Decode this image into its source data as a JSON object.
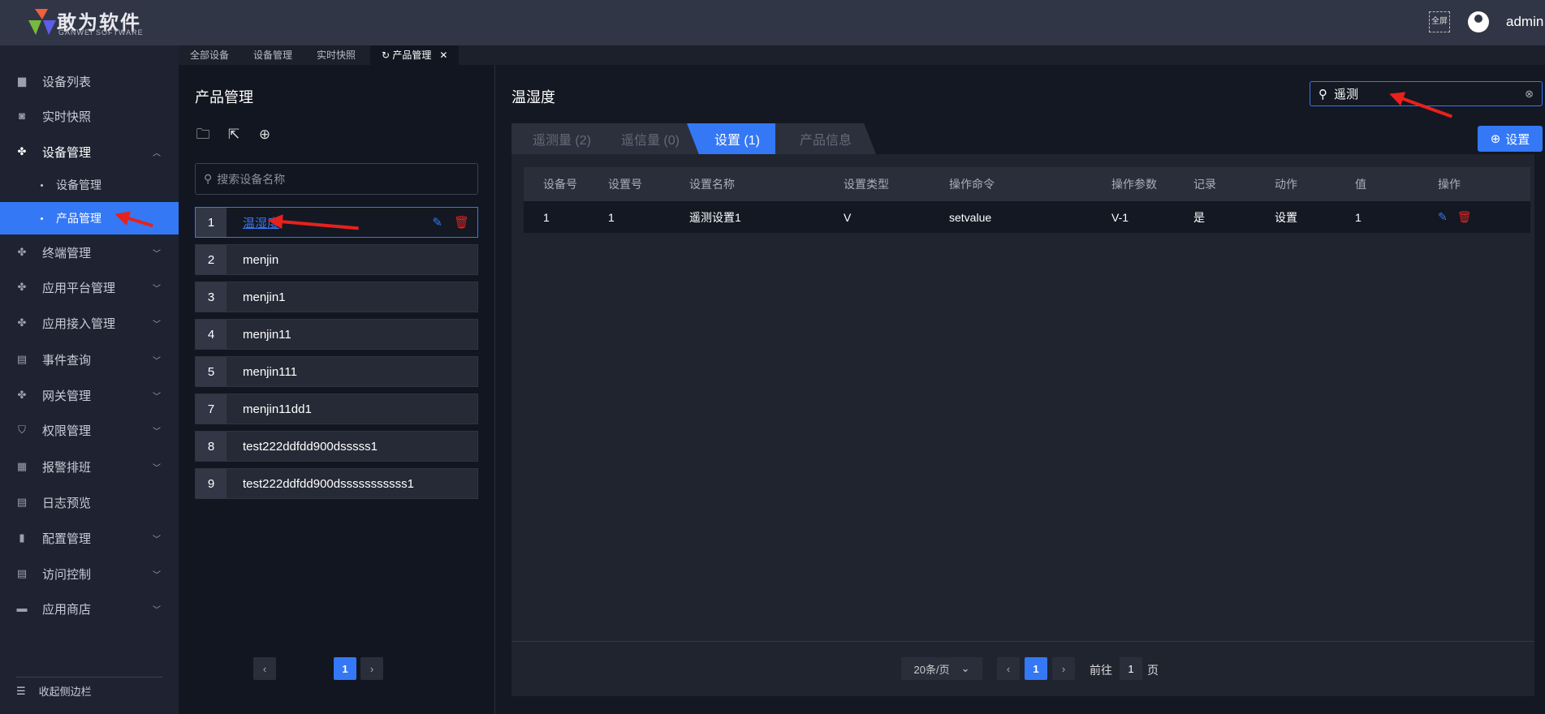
{
  "header": {
    "brand": "敢为软件",
    "brand_sub": "GANWEI SOFTWARE",
    "fullscreen": "全屏",
    "username": "admin"
  },
  "sidebar": {
    "items": [
      {
        "label": "设备列表",
        "icon": "monitor-icon"
      },
      {
        "label": "实时快照",
        "icon": "camera-icon"
      },
      {
        "label": "设备管理",
        "icon": "grid-icon",
        "open": true,
        "children": [
          {
            "label": "设备管理"
          },
          {
            "label": "产品管理",
            "active": true
          }
        ]
      },
      {
        "label": "终端管理",
        "icon": "grid-icon"
      },
      {
        "label": "应用平台管理",
        "icon": "grid-icon"
      },
      {
        "label": "应用接入管理",
        "icon": "grid-icon"
      },
      {
        "label": "事件查询",
        "icon": "document-icon"
      },
      {
        "label": "网关管理",
        "icon": "grid-icon"
      },
      {
        "label": "权限管理",
        "icon": "shield-icon"
      },
      {
        "label": "报警排班",
        "icon": "calendar-icon"
      },
      {
        "label": "日志预览",
        "icon": "log-icon"
      },
      {
        "label": "配置管理",
        "icon": "bookmark-icon"
      },
      {
        "label": "访问控制",
        "icon": "document-icon"
      },
      {
        "label": "应用商店",
        "icon": "store-icon"
      }
    ],
    "collapse_label": "收起侧边栏"
  },
  "page_tabs": [
    {
      "label": "全部设备"
    },
    {
      "label": "设备管理"
    },
    {
      "label": "实时快照"
    },
    {
      "label": "产品管理",
      "active": true
    }
  ],
  "left": {
    "title": "产品管理",
    "search_placeholder": "搜索设备名称",
    "products": [
      {
        "num": "1",
        "name": "温湿度"
      },
      {
        "num": "2",
        "name": "menjin"
      },
      {
        "num": "3",
        "name": "menjin1"
      },
      {
        "num": "4",
        "name": "menjin11"
      },
      {
        "num": "5",
        "name": "menjin111"
      },
      {
        "num": "7",
        "name": "menjin11dd1"
      },
      {
        "num": "8",
        "name": "test222ddfdd900dsssss1"
      },
      {
        "num": "9",
        "name": "test222ddfdd900dsssssssssss1"
      }
    ],
    "page": "1"
  },
  "right": {
    "title": "温湿度",
    "search_value": "遥测",
    "tabs": [
      {
        "label": "遥测量 (2)"
      },
      {
        "label": "遥信量 (0)"
      },
      {
        "label": "设置 (1)",
        "active": true
      },
      {
        "label": "产品信息"
      }
    ],
    "add_button": "设置",
    "columns": [
      "设备号",
      "设置号",
      "设置名称",
      "设置类型",
      "操作命令",
      "操作参数",
      "记录",
      "动作",
      "值",
      "操作"
    ],
    "rows": [
      [
        "1",
        "1",
        "遥测设置1",
        "V",
        "setvalue",
        "V-1",
        "是",
        "设置",
        "1"
      ]
    ],
    "pagination": {
      "page_size": "20条/页",
      "page": "1",
      "goto_label": "前往",
      "goto_value": "1",
      "page_unit": "页"
    }
  },
  "colors": {
    "accent": "#3478f6",
    "danger": "#e8211c"
  }
}
